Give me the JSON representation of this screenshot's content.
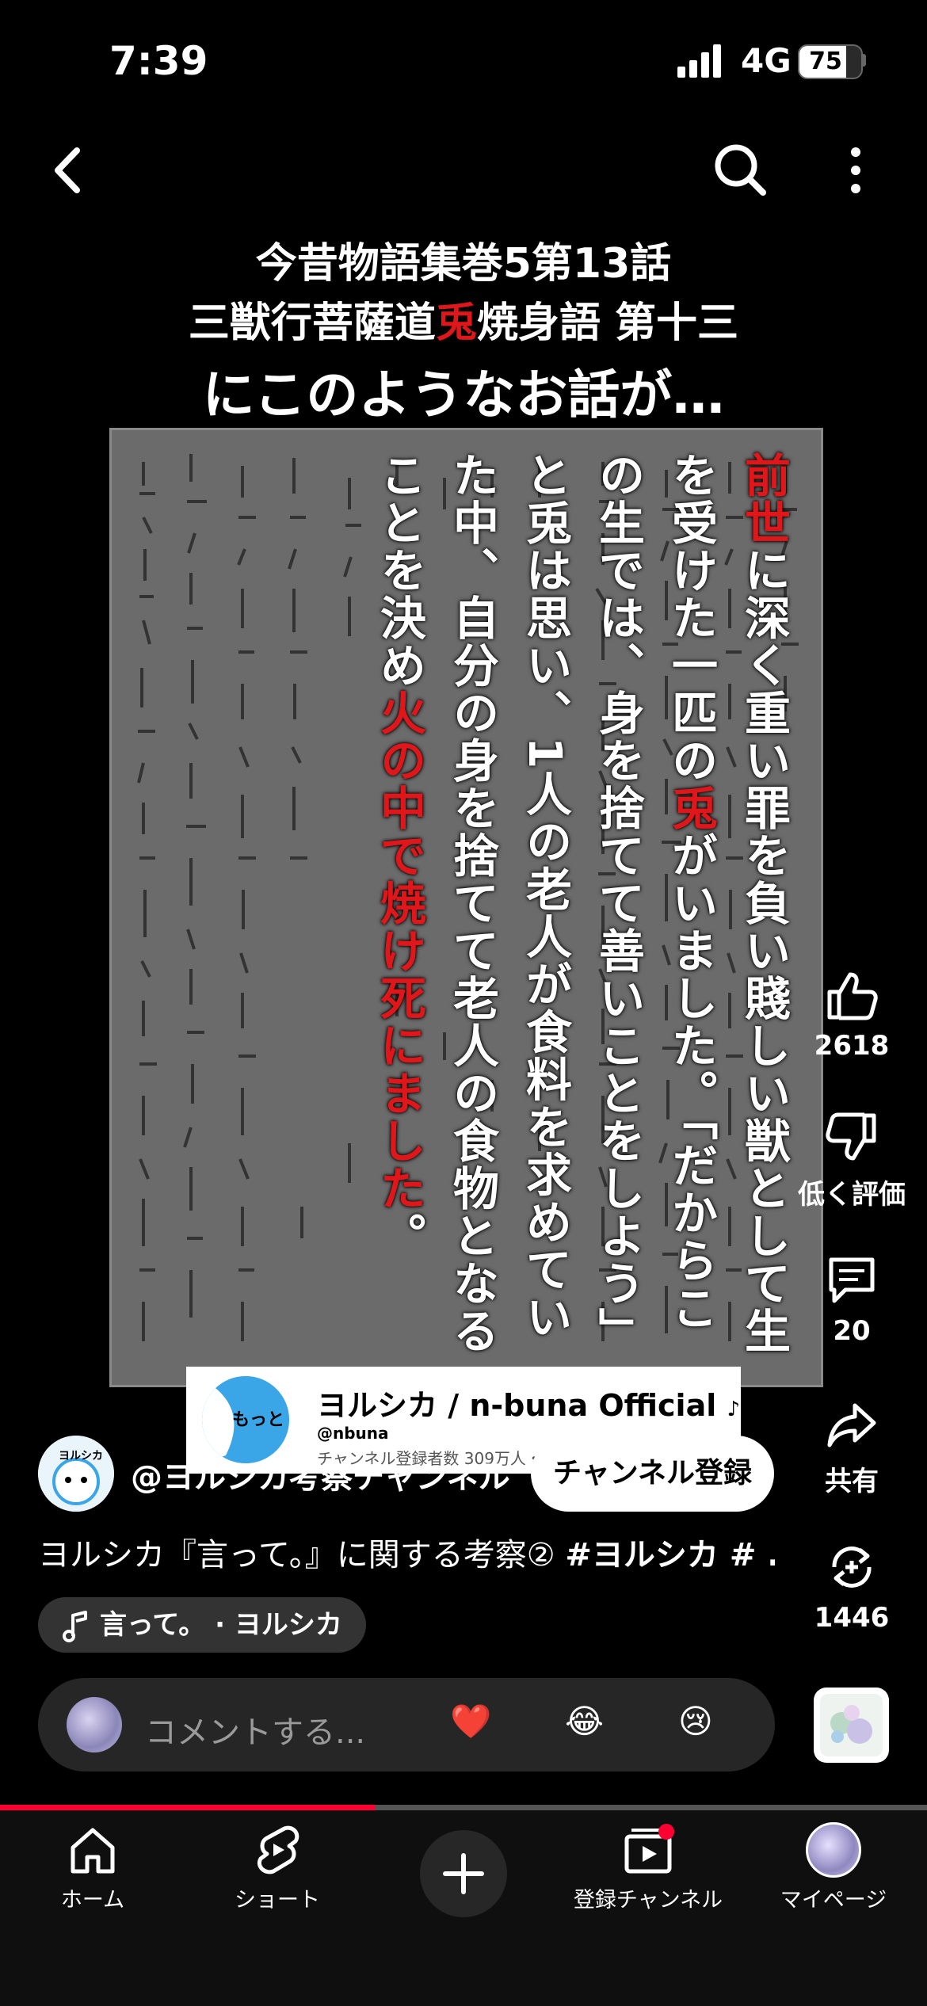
{
  "status": {
    "time": "7:39",
    "network": "4G",
    "battery": "75",
    "battery_level": 0.75
  },
  "video": {
    "title_line1": "今昔物語集巻5第13話",
    "title_line2_a": "三獣行菩薩道",
    "title_line2_red": "兎",
    "title_line2_b": "焼身語 第十三",
    "title_line3": "にこのようなお話が…",
    "vertical_text": {
      "red1": "前世",
      "t1": "に深く重い罪を負い賤しい獣として生を受けた一匹の",
      "red2": "兎",
      "t2": "がいました。「だからこの生では、身を捨てて善いことをしよう」と兎は思い、1人の老人が食料を求めていた中、自分の身を捨てて老人の食物となることを決め",
      "red3": "火の中で焼け死にました",
      "t3": "。"
    }
  },
  "actions": {
    "like_count": "2618",
    "dislike_label": "低く評価",
    "comment_count": "20",
    "share_label": "共有",
    "remix_count": "1446"
  },
  "card": {
    "avatar_text": "もっと",
    "name": "ヨルシカ / n-buna Official",
    "handle": "@nbuna",
    "subs": "チャンネル登録者数 309万人・7"
  },
  "channel": {
    "avatar_text": "ヨルシカ",
    "name": "@ヨルシカ考察チャンネル",
    "subscribe_label": "チャンネル登録"
  },
  "description": {
    "text": "ヨルシカ『言って。』に関する考察② ",
    "hashtags": "#ヨルシカ # ..."
  },
  "music": {
    "label": "言って。 · ヨルシカ"
  },
  "comment": {
    "placeholder": "コメントする...",
    "emoji1": "❤️",
    "emoji2": "😂",
    "emoji3": "😢"
  },
  "playback": {
    "progress": 0.405
  },
  "nav": {
    "home": "ホーム",
    "shorts": "ショート",
    "subscriptions": "登録チャンネル",
    "me": "マイページ"
  },
  "colors": {
    "accent_red": "#e0171a",
    "progress": "#ff0033",
    "nav_bg": "#0f0f0f"
  }
}
